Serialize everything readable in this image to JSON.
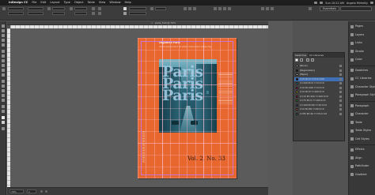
{
  "menubar": {
    "app": "InDesign CC",
    "items": [
      "File",
      "Edit",
      "Layout",
      "Type",
      "Object",
      "Table",
      "View",
      "Window",
      "Help"
    ],
    "clock": "Sun 10:22 AM",
    "user": "Angelo Mirhelliy"
  },
  "control_panel": {
    "workspace": "Essentials"
  },
  "document": {
    "tab_label": "paris_fold @ 79%"
  },
  "cover": {
    "headline": "Highfield Paris",
    "tagline": "lorem ipsum dolor sit amet consectetur adipiscing",
    "masthead": [
      "Paris",
      "Paris",
      "Paris"
    ],
    "volume": "Vol. 2, No. 33"
  },
  "status_bar": {
    "zoom": "79%",
    "page": "1"
  },
  "swatches": {
    "tabs": [
      "Swatches",
      "CC Libraries"
    ],
    "items": [
      {
        "name": "[None]",
        "color": "#ffffff",
        "selected": false
      },
      {
        "name": "[Registration]",
        "color": "#000000",
        "selected": false
      },
      {
        "name": "[Paper]",
        "color": "#ffffff",
        "selected": false
      },
      {
        "name": "C=0 M=0 Y=0 K=100",
        "color": "#1a1a1a",
        "selected": true
      },
      {
        "name": "C=100 M=0 Y=0 K=0",
        "color": "#00a0e3",
        "selected": false
      },
      {
        "name": "C=0 M=100 Y=0 K=0",
        "color": "#e4007c",
        "selected": false
      },
      {
        "name": "C=0 M=0 Y=100 K=0",
        "color": "#ffed00",
        "selected": false
      },
      {
        "name": "C=15 M=100 Y=100 K=0",
        "color": "#c8102e",
        "selected": false
      },
      {
        "name": "C=75 M=5 Y=100 K=0",
        "color": "#3aa935",
        "selected": false
      },
      {
        "name": "C=100 M=90 Y=10 K=0",
        "color": "#24408e",
        "selected": false
      },
      {
        "name": "C=0 M=65 Y=90 K=0",
        "color": "#e8672f",
        "selected": false
      },
      {
        "name": "C=85 M=40 Y=35 K=10",
        "color": "#2b6576",
        "selected": false
      }
    ]
  },
  "dock": {
    "items": [
      {
        "label": "Pages",
        "icon": "pages-icon"
      },
      {
        "label": "Layers",
        "icon": "layers-icon"
      },
      {
        "label": "Links",
        "icon": "links-icon"
      },
      {
        "label": "Stroke",
        "icon": "stroke-icon"
      },
      {
        "label": "Color",
        "icon": "color-icon"
      },
      {
        "label": "Swatches",
        "icon": "swatches-icon"
      },
      {
        "label": "CC Libraries",
        "icon": "cc-libraries-icon"
      },
      {
        "label": "Character Styles",
        "icon": "character-styles-icon"
      },
      {
        "label": "Paragraph Styles",
        "icon": "paragraph-styles-icon"
      },
      {
        "label": "Paragraph",
        "icon": "paragraph-icon"
      },
      {
        "label": "Character",
        "icon": "character-icon"
      },
      {
        "label": "Table",
        "icon": "table-icon"
      },
      {
        "label": "Table Styles",
        "icon": "table-styles-icon"
      },
      {
        "label": "Cell Styles",
        "icon": "cell-styles-icon"
      },
      {
        "label": "Effects",
        "icon": "effects-icon"
      },
      {
        "label": "Align",
        "icon": "align-icon"
      },
      {
        "label": "Pathfinder",
        "icon": "pathfinder-icon"
      },
      {
        "label": "Gradient",
        "icon": "gradient-icon"
      }
    ]
  }
}
